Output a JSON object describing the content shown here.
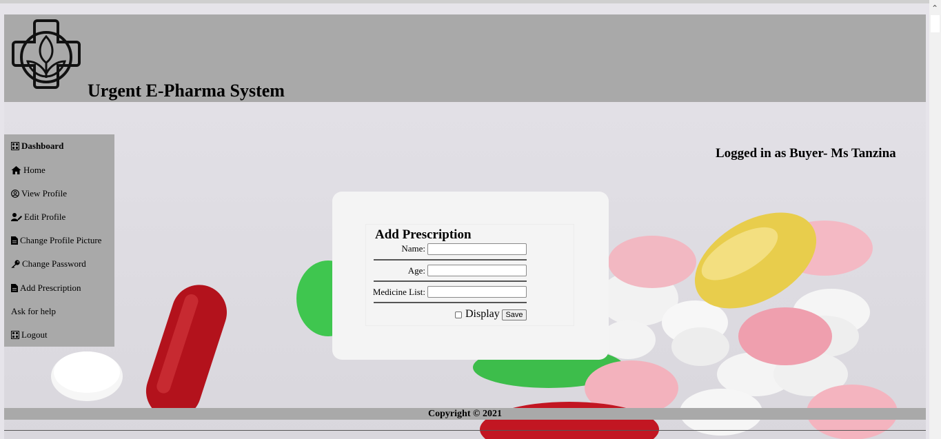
{
  "header": {
    "site_title": "Urgent E-Pharma System",
    "logo_icon": "pharmacy-cross-leaf-icon"
  },
  "sidebar": {
    "items": [
      {
        "label": "Dashboard",
        "icon": "grid-icon"
      },
      {
        "label": "Home",
        "icon": "home-icon"
      },
      {
        "label": "View Profile",
        "icon": "user-circle-icon"
      },
      {
        "label": "Edit Profile",
        "icon": "user-edit-icon"
      },
      {
        "label": "Change Profile Picture",
        "icon": "file-icon"
      },
      {
        "label": "Change Password",
        "icon": "key-icon"
      },
      {
        "label": "Add Prescription",
        "icon": "file-icon"
      },
      {
        "label": "Ask for help",
        "icon": ""
      },
      {
        "label": "Logout",
        "icon": "grid-icon"
      }
    ]
  },
  "status": {
    "logged_in": "Logged in as Buyer- Ms Tanzina"
  },
  "form": {
    "title": "Add Prescription",
    "name_label": "Name:",
    "name_value": "",
    "age_label": "Age:",
    "age_value": "",
    "medicine_label": "Medicine List:",
    "medicine_value": "",
    "display_label": "Display",
    "display_checked": false,
    "save_label": "Save"
  },
  "footer": {
    "copyright": "Copyright © 2021"
  },
  "colors": {
    "header_bg": "#a9a9a9",
    "page_bg": "#e6e4ea",
    "card_bg": "#f4f4f4"
  }
}
